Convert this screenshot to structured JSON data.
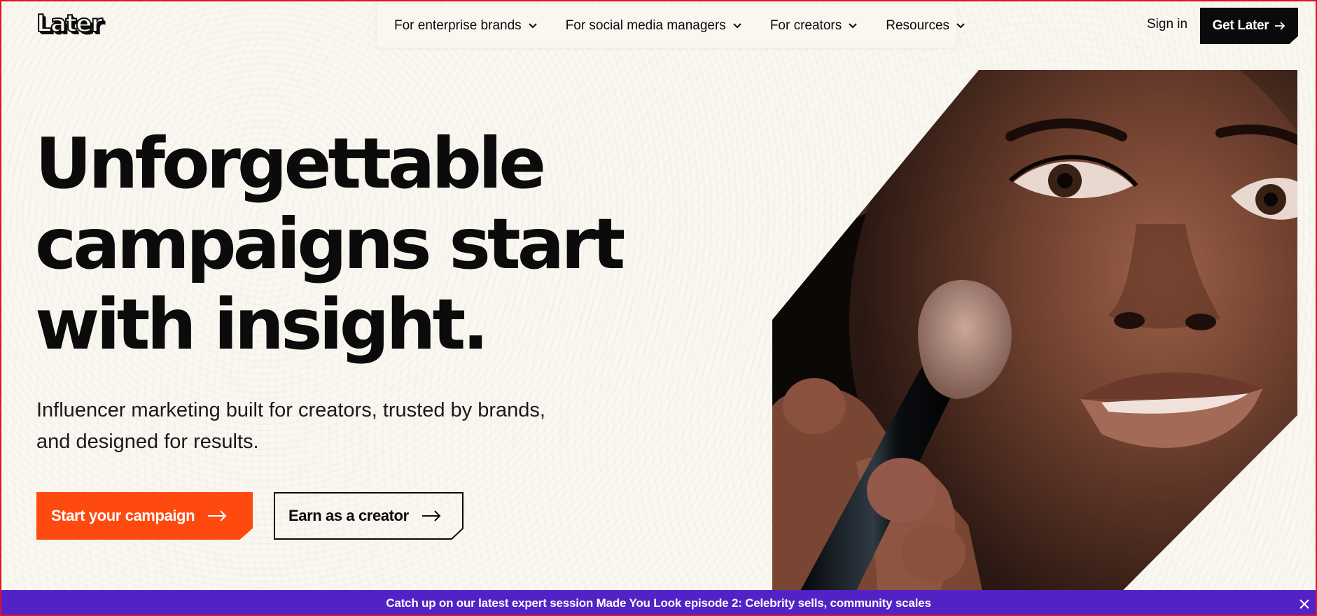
{
  "brand": {
    "logo_text": "Later"
  },
  "nav": {
    "items": [
      {
        "label": "For enterprise brands",
        "icon": "chevron-down-icon"
      },
      {
        "label": "For social media managers",
        "icon": "chevron-down-icon"
      },
      {
        "label": "For creators",
        "icon": "chevron-down-icon"
      },
      {
        "label": "Resources",
        "icon": "chevron-down-icon"
      }
    ],
    "sign_in": "Sign in",
    "cta": "Get Later"
  },
  "hero": {
    "headline_lines": [
      "Unforgettable",
      "campaigns start",
      "with insight."
    ],
    "subhead_lines": [
      "Influencer marketing built for creators, trusted by brands,",
      "and designed for results."
    ],
    "primary_cta": "Start your campaign",
    "secondary_cta": "Earn as a creator",
    "image_icon": "makeup-brush-portrait-photo"
  },
  "banner": {
    "text": "Catch up on our latest expert session Made You Look episode 2: Celebrity sells, community scales",
    "close_icon": "close-icon"
  },
  "colors": {
    "background": "#faf6f0",
    "primary_cta": "#ff4a0f",
    "dark": "#0b0b0b",
    "banner": "#5222c7"
  }
}
